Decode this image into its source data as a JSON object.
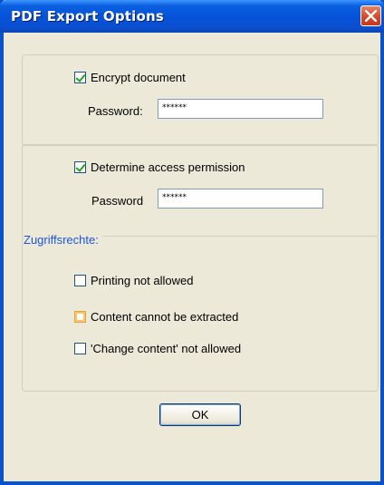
{
  "window": {
    "title": "PDF Export Options"
  },
  "encrypt": {
    "checkbox_label": "Encrypt document",
    "checked": true,
    "password_label": "Password:",
    "password_value": "******"
  },
  "access": {
    "checkbox_label": "Determine access permission",
    "checked": true,
    "password_label": "Password",
    "password_value": "******"
  },
  "permissions": {
    "group_label": "Zugriffsrechte:",
    "items": [
      {
        "label": "Printing not allowed",
        "checked": false
      },
      {
        "label": "Content cannot be extracted",
        "checked": false
      },
      {
        "label": "'Change content' not allowed",
        "checked": false
      }
    ]
  },
  "ok_label": "OK",
  "colors": {
    "titlebar": "#0553d8",
    "dialog_bg": "#ece9d8",
    "group_label": "#1b56d6",
    "close": "#d5482a"
  }
}
